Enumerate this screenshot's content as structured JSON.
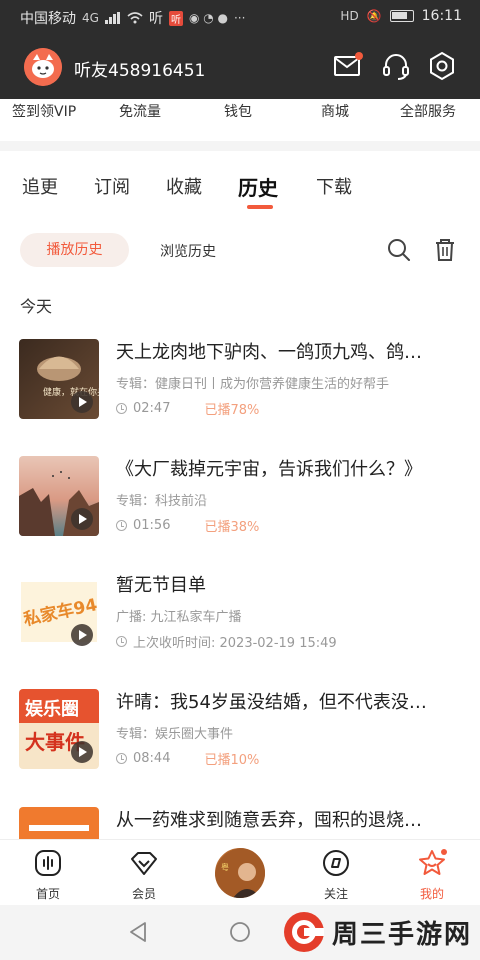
{
  "status_bar": {
    "carrier": "中国移动",
    "net": "4G",
    "app_badge": "听",
    "time": "16:11"
  },
  "header": {
    "username": "听友458916451",
    "icons": [
      "mail-icon",
      "headset-icon",
      "settings-hex-icon"
    ]
  },
  "services": [
    "签到领VIP",
    "免流量",
    "钱包",
    "商城",
    "全部服务"
  ],
  "tabs": [
    "追更",
    "订阅",
    "收藏",
    "历史",
    "下载"
  ],
  "active_tab": "历史",
  "subtabs": {
    "active": "播放历史",
    "other": "浏览历史"
  },
  "section_title": "今天",
  "items": [
    {
      "title": "天上龙肉地下驴肉、一鸽顶九鸡、鸽…",
      "subtitle": "专辑：健康日刊丨成为你营养健康生活的好帮手",
      "duration": "02:47",
      "played": "已播78%",
      "thumb_text": "健康，就在你身边"
    },
    {
      "title": "《大厂裁掉元宇宙，告诉我们什么？》",
      "subtitle": "专辑：科技前沿",
      "duration": "01:56",
      "played": "已播38%",
      "thumb_text": ""
    },
    {
      "title": "暂无节目单",
      "subtitle": "广播: 九江私家车广播",
      "duration": "上次收听时间: 2023-02-19 15:49",
      "played": "",
      "thumb_text": "私家车94.6"
    },
    {
      "title": "许晴：我54岁虽没结婚，但不代表没…",
      "subtitle": "专辑：娱乐圈大事件",
      "duration": "08:44",
      "played": "已播10%",
      "thumb_text": "娱乐圈大事件"
    },
    {
      "title": "从一药难求到随意丢弃，囤积的退烧…",
      "subtitle": "",
      "duration": "",
      "played": "",
      "thumb_text": ""
    }
  ],
  "bottom_nav": [
    {
      "label": "首页",
      "icon": "home-icon"
    },
    {
      "label": "会员",
      "icon": "vip-icon"
    },
    {
      "label": "",
      "icon": "center-avatar"
    },
    {
      "label": "关注",
      "icon": "follow-icon"
    },
    {
      "label": "我的",
      "icon": "mine-icon"
    }
  ],
  "watermark": "周三手游网",
  "colors": {
    "accent": "#f25a3c",
    "header_bg": "#2d2d2d",
    "played": "#f3a07e"
  }
}
